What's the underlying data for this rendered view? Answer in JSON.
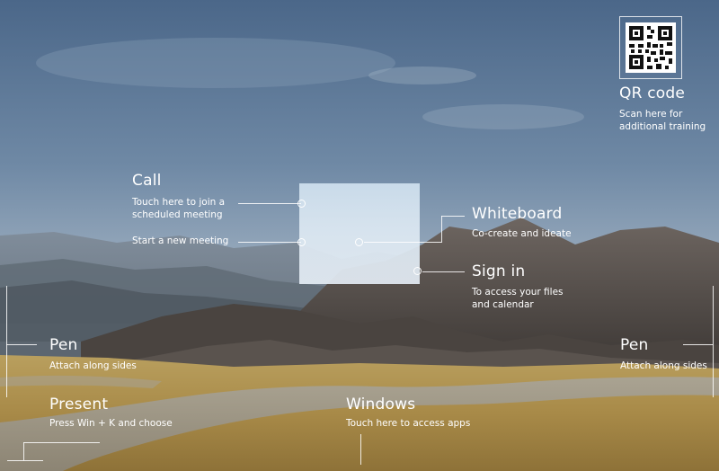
{
  "qr": {
    "icon": "qr-code-icon",
    "title": "QR code",
    "desc_line1": "Scan here for",
    "desc_line2": "additional training"
  },
  "call": {
    "title": "Call",
    "join_line1": "Touch here to join a",
    "join_line2": "scheduled meeting",
    "new_meeting": "Start a new meeting"
  },
  "whiteboard": {
    "title": "Whiteboard",
    "desc": "Co-create and ideate"
  },
  "signin": {
    "title": "Sign in",
    "desc_line1": "To access your files",
    "desc_line2": "and calendar"
  },
  "pen_left": {
    "title": "Pen",
    "desc": "Attach along sides"
  },
  "pen_right": {
    "title": "Pen",
    "desc": "Attach along sides"
  },
  "present": {
    "title": "Present",
    "desc": "Press Win + K and choose"
  },
  "windows": {
    "title": "Windows",
    "desc": "Touch here to access apps"
  }
}
